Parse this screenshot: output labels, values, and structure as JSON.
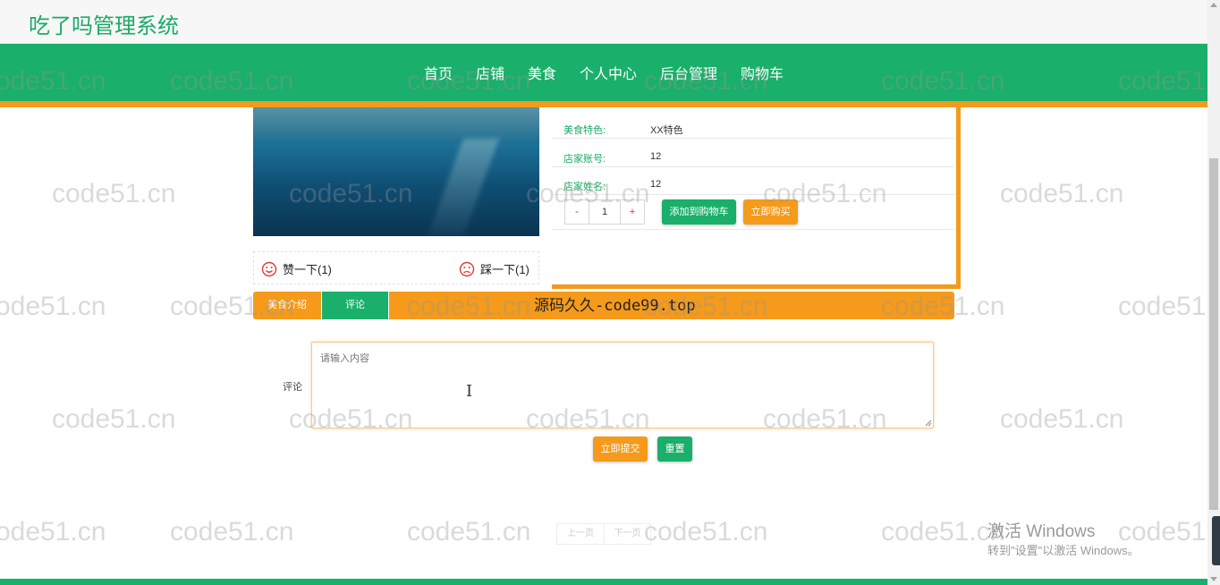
{
  "site": {
    "title": "吃了吗管理系统"
  },
  "nav": {
    "items": [
      "首页",
      "店铺",
      "美食",
      "个人中心",
      "后台管理",
      "购物车"
    ]
  },
  "product": {
    "rows": [
      {
        "label": "美食特色:",
        "value": "XX特色"
      },
      {
        "label": "店家账号:",
        "value": "12"
      },
      {
        "label": "店家姓名:",
        "value": "12"
      }
    ],
    "quantity": {
      "minus": "-",
      "value": "1",
      "plus": "+"
    },
    "add_to_cart_label": "添加到购物车",
    "buy_now_label": "立即购买"
  },
  "vote": {
    "like_label": "赞一下(1)",
    "dislike_label": "踩一下(1)"
  },
  "tabs": {
    "items": [
      "美食介绍",
      "评论"
    ],
    "active": "评论",
    "overlay_text": "源码久久-code99.top"
  },
  "comment": {
    "label": "评论",
    "placeholder": "请输入内容",
    "submit_label": "立即提交",
    "reset_label": "重置"
  },
  "pager": {
    "prev_label": "上一页",
    "next_label": "下一页"
  },
  "watermark": {
    "text": "code51.cn"
  },
  "os_notice": {
    "title": "激活 Windows",
    "subtitle": "转到\"设置\"以激活 Windows。"
  },
  "colors": {
    "brand_green": "#1aaf6a",
    "accent_orange": "#f59a1b"
  },
  "icons": {
    "like": "smile-icon",
    "dislike": "frown-icon"
  }
}
